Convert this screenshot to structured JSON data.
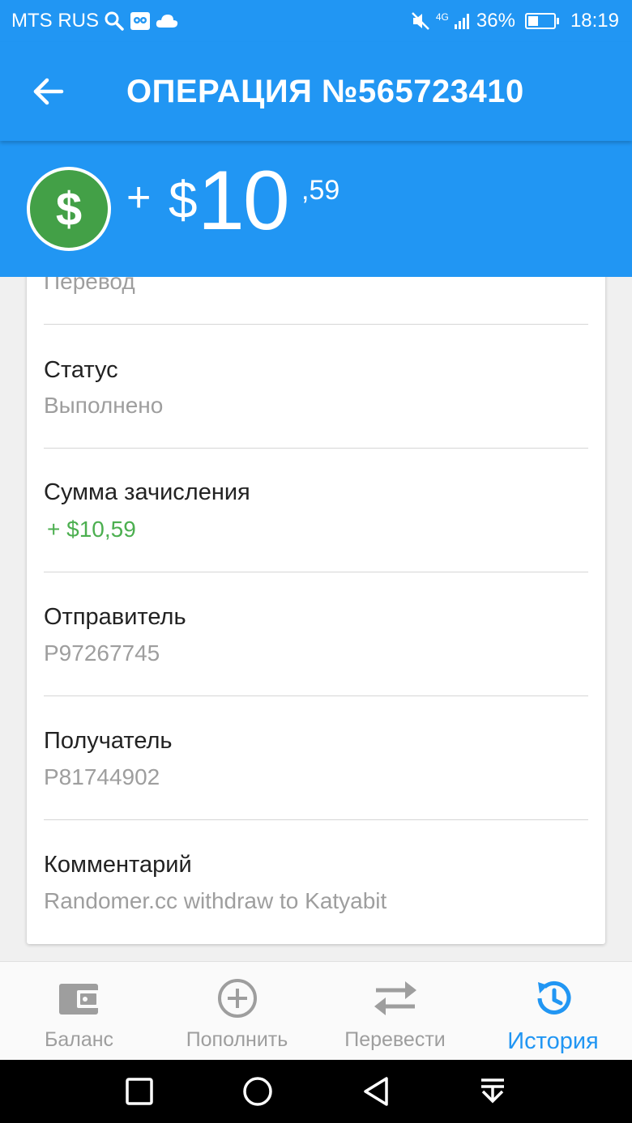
{
  "status_bar": {
    "carrier": "MTS RUS",
    "network": "4G",
    "battery_percent": "36%",
    "battery_level": 0.36,
    "time": "18:19",
    "icons": [
      "search-icon",
      "notification-app-icon",
      "cloud-icon",
      "mute-icon",
      "signal-icon",
      "battery-icon"
    ]
  },
  "app_bar": {
    "title": "ОПЕРАЦИЯ №565723410",
    "back_icon": "arrow-back-icon"
  },
  "amount": {
    "sign": "+",
    "currency_symbol": "$",
    "integer": "10",
    "fraction": ",59",
    "coin_symbol": "$"
  },
  "details": [
    {
      "label": "",
      "value": "Перевод"
    },
    {
      "label": "Статус",
      "value": "Выполнено"
    },
    {
      "label": "Сумма зачисления",
      "value": "+ $10,59",
      "color": "#4caf50"
    },
    {
      "label": "Отправитель",
      "value": "P97267745"
    },
    {
      "label": "Получатель",
      "value": "P81744902"
    },
    {
      "label": "Комментарий",
      "value": "Randomer.cc withdraw to Katyabit"
    }
  ],
  "bottom_nav": {
    "items": [
      {
        "label": "Баланс",
        "icon": "wallet-icon",
        "active": false
      },
      {
        "label": "Пополнить",
        "icon": "add-circle-icon",
        "active": false
      },
      {
        "label": "Перевести",
        "icon": "swap-arrows-icon",
        "active": false
      },
      {
        "label": "История",
        "icon": "history-icon",
        "active": true
      }
    ]
  },
  "colors": {
    "primary": "#2196f3",
    "coin": "#43a047",
    "positive": "#4caf50",
    "inactive_nav": "#9e9e9e"
  }
}
